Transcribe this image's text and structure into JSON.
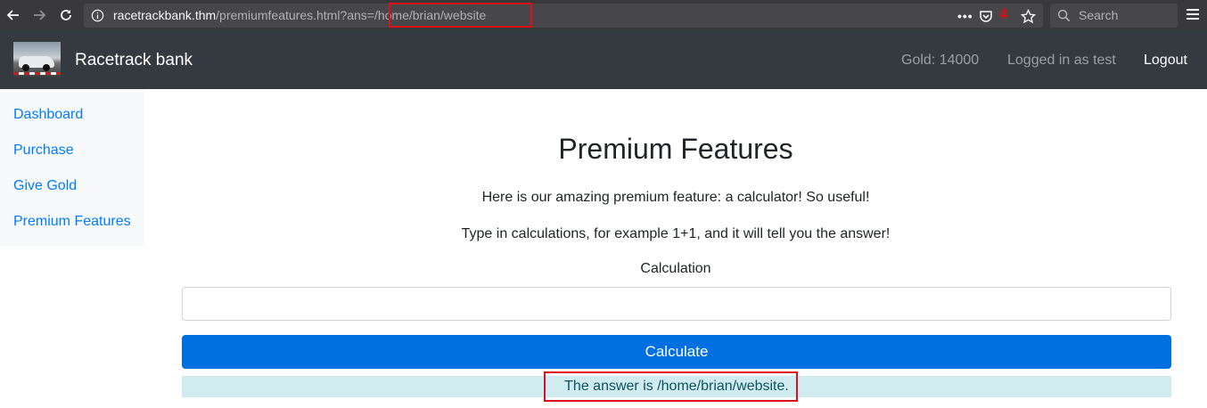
{
  "browser": {
    "url_host": "racetrackbank.thm",
    "url_path": "/premiumfeatures.html?ans=/home/brian/website",
    "annotation_number": "4",
    "search_placeholder": "Search",
    "url_dots": "•••"
  },
  "navbar": {
    "brand": "Racetrack bank",
    "gold": "Gold: 14000",
    "logged_in": "Logged in as test",
    "logout": "Logout"
  },
  "sidebar": {
    "items": [
      {
        "label": "Dashboard"
      },
      {
        "label": "Purchase"
      },
      {
        "label": "Give Gold"
      },
      {
        "label": "Premium Features"
      }
    ]
  },
  "main": {
    "title": "Premium Features",
    "intro": "Here is our amazing premium feature: a calculator! So useful!",
    "instructions": "Type in calculations, for example 1+1, and it will tell you the answer!",
    "calc_label": "Calculation",
    "calc_value": "",
    "calc_button": "Calculate",
    "answer": "The answer is /home/brian/website."
  },
  "colors": {
    "browser_bar": "#38383d",
    "navbar": "#343a40",
    "link": "#007bff",
    "button": "#0070e0",
    "answer_bg": "#d1ecf1",
    "annotation": "#e0101b"
  },
  "icons": [
    "back-arrow-icon",
    "forward-arrow-icon",
    "reload-icon",
    "info-icon",
    "pocket-icon",
    "star-icon",
    "search-icon",
    "hamburger-menu-icon"
  ]
}
